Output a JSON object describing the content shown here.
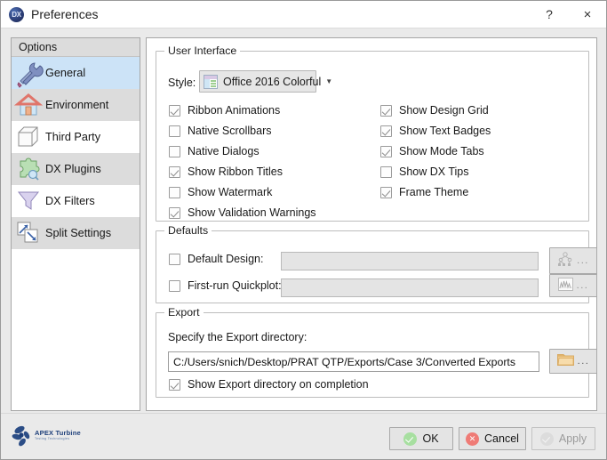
{
  "window": {
    "title": "Preferences",
    "icon": "DX",
    "help_label": "?",
    "close_label": "×"
  },
  "sidebar": {
    "header": "Options",
    "items": [
      {
        "label": "General",
        "icon": "wrench-screwdriver-icon",
        "selected": true
      },
      {
        "label": "Environment",
        "icon": "house-icon",
        "selected": false
      },
      {
        "label": "Third Party",
        "icon": "cube-icon",
        "selected": false
      },
      {
        "label": "DX Plugins",
        "icon": "puzzle-piece-icon",
        "selected": false
      },
      {
        "label": "DX Filters",
        "icon": "funnel-icon",
        "selected": false
      },
      {
        "label": "Split Settings",
        "icon": "split-arrows-icon",
        "selected": false
      }
    ]
  },
  "user_interface": {
    "title": "User Interface",
    "style_label": "Style:",
    "style_value": "Office 2016 Colorful",
    "left_checkboxes": [
      {
        "label": "Ribbon Animations",
        "checked": true
      },
      {
        "label": "Native Scrollbars",
        "checked": false
      },
      {
        "label": "Native Dialogs",
        "checked": false
      },
      {
        "label": "Show Ribbon Titles",
        "checked": true
      },
      {
        "label": "Show Watermark",
        "checked": false
      },
      {
        "label": "Show Validation Warnings",
        "checked": true
      }
    ],
    "right_checkboxes": [
      {
        "label": "Show Design Grid",
        "checked": true
      },
      {
        "label": "Show Text Badges",
        "checked": true
      },
      {
        "label": "Show Mode Tabs",
        "checked": true
      },
      {
        "label": "Show DX Tips",
        "checked": false
      },
      {
        "label": "Frame Theme",
        "checked": true
      }
    ]
  },
  "defaults": {
    "title": "Defaults",
    "rows": [
      {
        "label": "Default Design:",
        "checked": false,
        "value": "",
        "browse_icon": "tree-hierarchy-icon",
        "browse_dots": "..."
      },
      {
        "label": "First-run Quickplot:",
        "checked": false,
        "value": "",
        "browse_icon": "chart-icon",
        "browse_dots": "..."
      }
    ]
  },
  "export": {
    "title": "Export",
    "instruction": "Specify the Export directory:",
    "directory": "C:/Users/snich/Desktop/PRAT QTP/Exports/Case 3/Converted Exports",
    "browse_icon": "folder-icon",
    "browse_dots": "...",
    "show_on_completion": {
      "label": "Show Export directory on completion",
      "checked": true
    }
  },
  "footer": {
    "logo_primary": "APEX Turbine",
    "logo_secondary": "Testing Technologies",
    "buttons": [
      {
        "label": "OK",
        "icon": "green-check-icon",
        "enabled": true
      },
      {
        "label": "Cancel",
        "icon": "red-x-icon",
        "enabled": true
      },
      {
        "label": "Apply",
        "icon": "gray-check-icon",
        "enabled": false
      }
    ]
  },
  "colors": {
    "selection": "#cce3f7",
    "accent": "#2d3f78",
    "ok_green": "#a7dfa0",
    "cancel_red": "#ef7b76"
  }
}
